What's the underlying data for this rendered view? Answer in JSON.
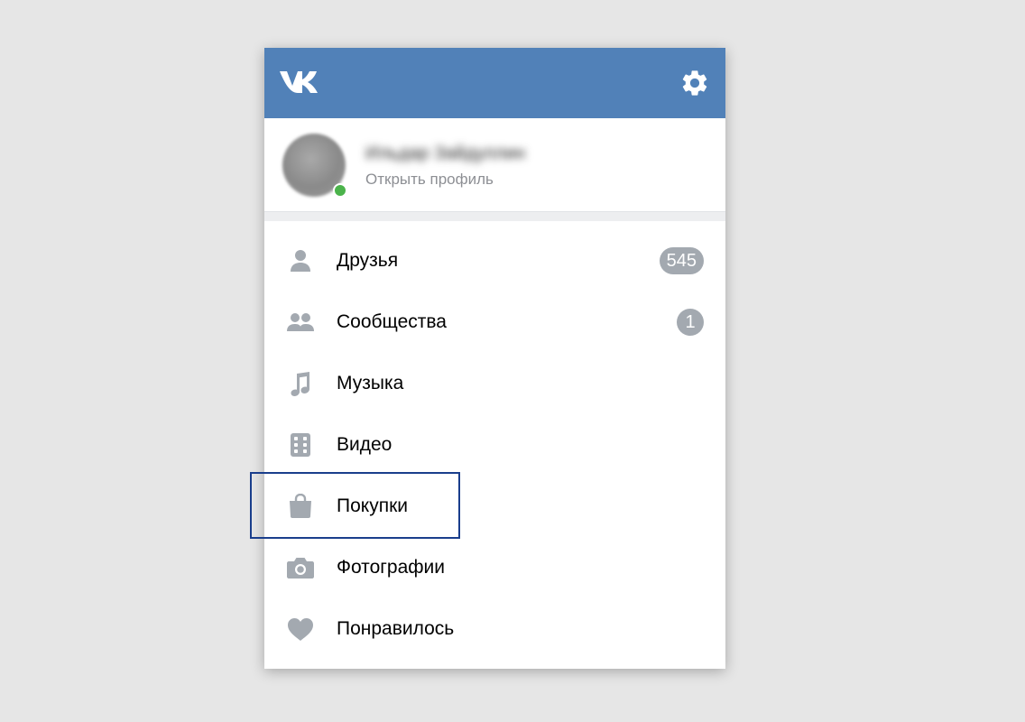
{
  "header": {
    "logo_icon": "vk-logo",
    "settings_icon": "gear-icon",
    "bg_color": "#5181b8"
  },
  "profile": {
    "name": "Ильдар Зайдуллин",
    "subtitle": "Открыть профиль",
    "online": true
  },
  "menu": {
    "items": [
      {
        "label": "Друзья",
        "icon": "person-icon",
        "badge": "545"
      },
      {
        "label": "Сообщества",
        "icon": "group-icon",
        "badge": "1"
      },
      {
        "label": "Музыка",
        "icon": "music-note-icon"
      },
      {
        "label": "Видео",
        "icon": "film-icon"
      },
      {
        "label": "Покупки",
        "icon": "shopping-bag-icon",
        "highlighted": true
      },
      {
        "label": "Фотографии",
        "icon": "camera-icon"
      },
      {
        "label": "Понравилось",
        "icon": "heart-icon"
      }
    ]
  },
  "colors": {
    "accent": "#5181b8",
    "icon_gray": "#a3a9b0",
    "highlight_border": "#1a3e8c",
    "online": "#4bb34b"
  }
}
